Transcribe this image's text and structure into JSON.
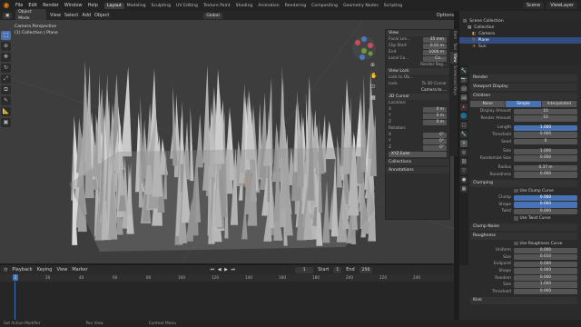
{
  "menu": [
    "File",
    "Edit",
    "Render",
    "Window",
    "Help"
  ],
  "workspaces": [
    "Layout",
    "Modeling",
    "Sculpting",
    "UV Editing",
    "Texture Paint",
    "Shading",
    "Animation",
    "Rendering",
    "Compositing",
    "Geometry Nodes",
    "Scripting"
  ],
  "active_workspace": "Layout",
  "scene_label": "Scene",
  "view_layer_label": "ViewLayer",
  "viewport_header": {
    "mode": "Object Mode",
    "view": "View",
    "select": "Select",
    "add": "Add",
    "object": "Object",
    "orientation": "Global",
    "options": "Options"
  },
  "viewport_info": {
    "perspective": "Camera Perspective",
    "collection": "(1) Collection | Plane"
  },
  "npanel": {
    "view_title": "View",
    "focal_length_label": "Focal Len...",
    "focal_length": "35 mm",
    "clip_start_label": "Clip Start",
    "clip_start": "0.01 m",
    "clip_end_label": "End",
    "clip_end": "1000 m",
    "local_camera_label": "Local Ca...",
    "local_camera": "Ca...",
    "render_region": "Render Reg...",
    "view_lock_title": "View Lock",
    "lock_to_object": "Lock to Ob...",
    "lock_label": "Lock",
    "to_3d_cursor": "To 3D Cursor",
    "camera_to_view": "Camera to ...",
    "cursor_title": "3D Cursor",
    "location_label": "Location:",
    "rotation_label": "Rotation:",
    "x": "X",
    "y": "Y",
    "z": "Z",
    "loc_value": "0 m",
    "rot_value": "0°",
    "rotation_mode": "XYZ Euler",
    "collections": "Collections",
    "annotations": "Annotations",
    "tabs": [
      "Item",
      "Tool",
      "View",
      "Screencast Keys"
    ]
  },
  "timeline": {
    "playback": "Playback",
    "keying": "Keying",
    "view": "View",
    "marker": "Marker",
    "current_frame": "1",
    "start_label": "Start",
    "start": "1",
    "end_label": "End",
    "end": "250",
    "ruler": [
      "1",
      "20",
      "40",
      "60",
      "80",
      "100",
      "120",
      "140",
      "160",
      "180",
      "200",
      "220",
      "240"
    ]
  },
  "status": [
    "Set Active Modifier",
    "Pan View",
    "Context Menu"
  ],
  "outliner": {
    "title": "Scene Collection",
    "items": [
      "Collection",
      "Camera",
      "Plane",
      "Sun"
    ]
  },
  "properties": {
    "sections_top": [
      "Render",
      "Viewport Display"
    ],
    "children_label": "Children",
    "children_modes": [
      "None",
      "Simple",
      "Interpolated"
    ],
    "children_mode_active": "Simple",
    "display_amount_label": "Display Amount",
    "display_amount": "10",
    "render_amount_label": "Render Amount",
    "render_amount": "10",
    "length_label": "Length",
    "length": "1.000",
    "threshold_label": "Threshold",
    "threshold": "0.000",
    "seed_label": "Seed",
    "seed": "0",
    "size_label": "Size",
    "size": "1.000",
    "randomize_size_label": "Randomize Size",
    "randomize_size": "0.000",
    "radius_label": "Radius",
    "radius": "0.37 m",
    "roundness_label": "Roundness",
    "roundness": "0.000",
    "clumping_title": "Clumping",
    "use_clump_curve": "Use Clump Curve",
    "clump_label": "Clump",
    "clump": "0.000",
    "shape_label": "Shape",
    "shape": "0.000",
    "twist_label": "Twist",
    "twist": "0.000",
    "use_twist_curve": "Use Twist Curve",
    "clump_noise": "Clump Noise",
    "roughness_title": "Roughness",
    "use_roughness_curve": "Use Roughness Curve",
    "uniform_label": "Uniform",
    "uniform": "0.000",
    "r_size_label": "Size",
    "r_size": "0.010",
    "endpoint_label": "Endpoint",
    "endpoint": "0.000",
    "r_shape_label": "Shape",
    "r_shape": "0.000",
    "random_label": "Random",
    "random": "0.000",
    "r_size2_label": "Size",
    "r_size2": "1.000",
    "r_threshold_label": "Threshold",
    "r_threshold": "0.000",
    "kink": "Kink"
  },
  "colors": {
    "accent": "#4772b3",
    "viewport_bg": "#3d3d3d",
    "grass": "#bfbfbf"
  }
}
